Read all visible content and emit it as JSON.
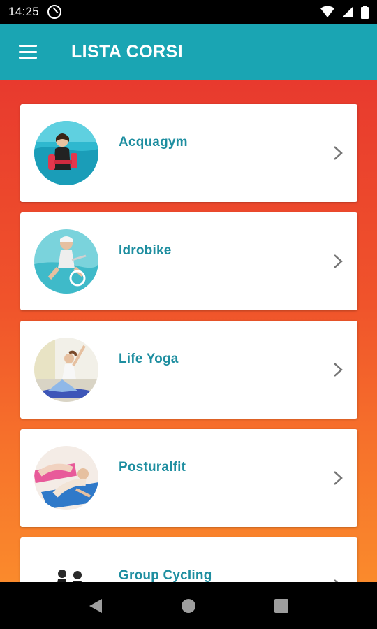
{
  "status_bar": {
    "time": "14:25"
  },
  "app_bar": {
    "title": "LISTA CORSI"
  },
  "courses": [
    {
      "label": "Acquagym"
    },
    {
      "label": "Idrobike"
    },
    {
      "label": "Life Yoga"
    },
    {
      "label": "Posturalfit"
    },
    {
      "label": "Group Cycling"
    }
  ],
  "colors": {
    "toolbar": "#1aa5b3",
    "label": "#1e8ea0",
    "gradient_top": "#e83a2e",
    "gradient_bottom": "#fa8a2c"
  }
}
